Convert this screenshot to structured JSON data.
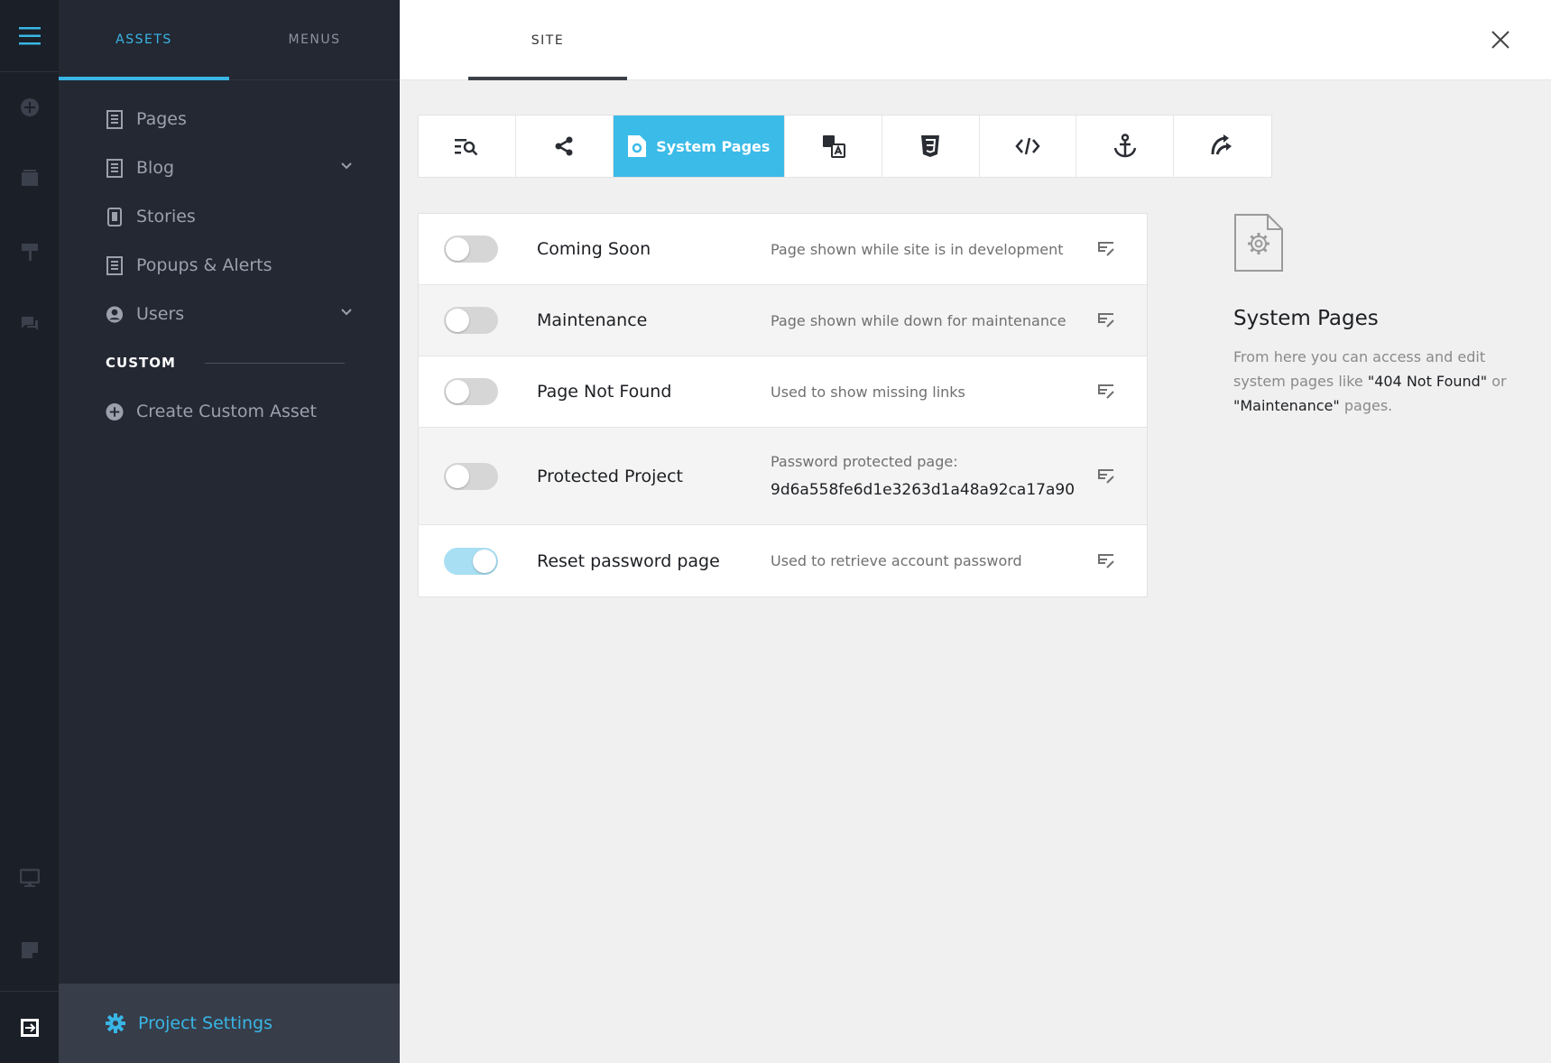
{
  "colors": {
    "accent": "#39b6e6",
    "rail": "#1b1f27",
    "sidebar": "#232833"
  },
  "sidebar": {
    "tabs": [
      {
        "label": "ASSETS"
      },
      {
        "label": "MENUS"
      }
    ],
    "items": [
      {
        "label": "Pages",
        "icon": "page-icon"
      },
      {
        "label": "Blog",
        "icon": "page-icon"
      },
      {
        "label": "Stories",
        "icon": "story-icon"
      },
      {
        "label": "Popups & Alerts",
        "icon": "page-icon"
      },
      {
        "label": "Users",
        "icon": "user-icon"
      }
    ],
    "custom_heading": "CUSTOM",
    "create_custom": "Create Custom Asset",
    "footer_label": "Project Settings"
  },
  "header": {
    "site_tab": "SITE"
  },
  "toolbar": {
    "active_label": "System Pages"
  },
  "rows": [
    {
      "name": "Coming Soon",
      "desc": "Page shown while site is in development",
      "enabled": false
    },
    {
      "name": "Maintenance",
      "desc": "Page shown while down for maintenance",
      "enabled": false
    },
    {
      "name": "Page Not Found",
      "desc": "Used to show missing links",
      "enabled": false
    },
    {
      "name": "Protected Project",
      "desc": "Password protected page:",
      "code": "9d6a558fe6d1e3263d1a48a92ca17a90",
      "enabled": false
    },
    {
      "name": "Reset password page",
      "desc": "Used to retrieve account password",
      "enabled": true
    }
  ],
  "info": {
    "title": "System Pages",
    "text_1": "From here you can access and edit system pages like ",
    "bold_1": "\"404 Not Found\"",
    "text_2": " or ",
    "bold_2": "\"Maintenance\"",
    "text_3": " pages."
  }
}
